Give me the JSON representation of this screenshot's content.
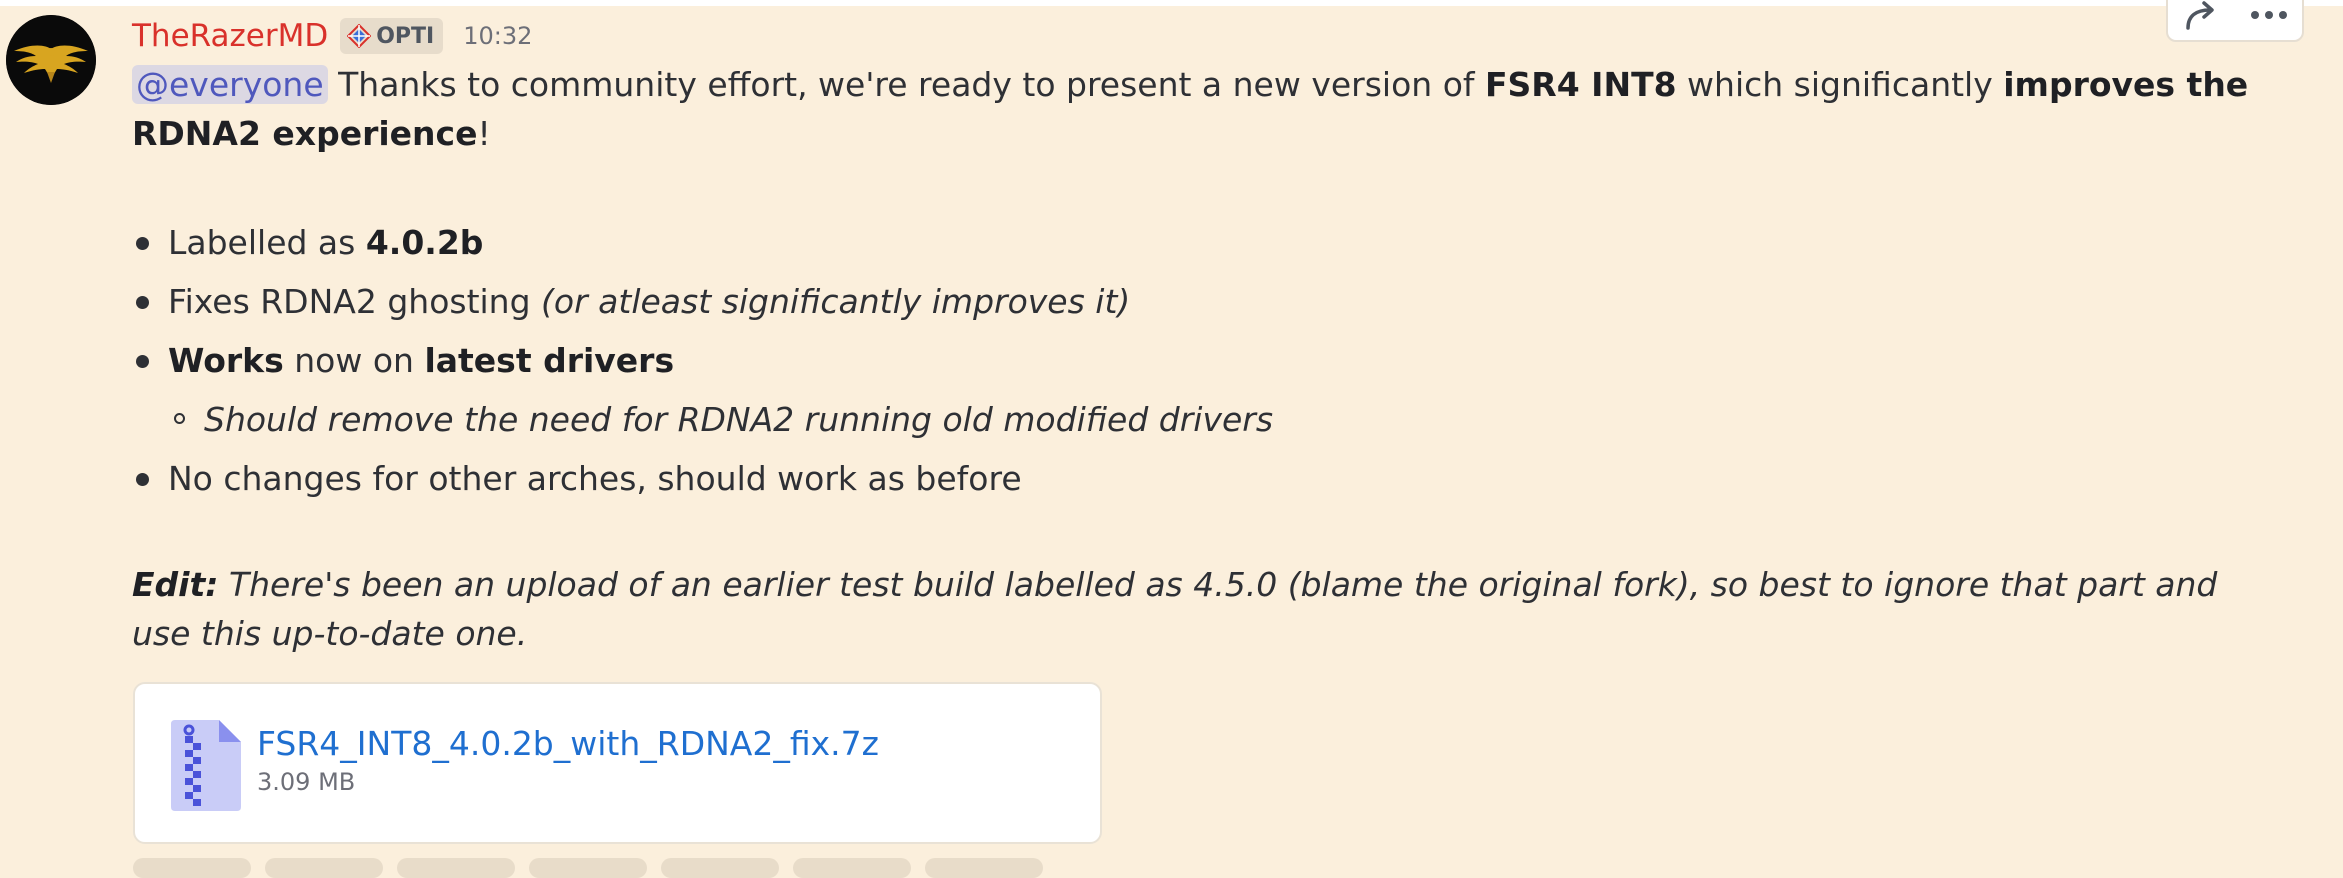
{
  "message": {
    "author": "TheRazerMD",
    "role_tag": "OPTI",
    "timestamp": "10:32",
    "mention": "@everyone",
    "intro": {
      "t1": " Thanks to community effort, we're ready to present a new version of ",
      "b1": "FSR4 INT8",
      "t2": " which significantly ",
      "b2": "improves the RDNA2 experience",
      "t3": "!"
    },
    "bullets": [
      {
        "t1": "Labelled as ",
        "b1": "4.0.2b"
      },
      {
        "t1": "Fixes RDNA2 ghosting ",
        "i1": "(or atleast significantly improves it)"
      },
      {
        "b1": "Works",
        "t1": " now on ",
        "b2": "latest drivers"
      },
      {
        "sub": "Should remove the need for RDNA2 running old modified drivers"
      },
      {
        "t1": "No changes for other arches, should work as before"
      }
    ],
    "edit": {
      "label": "Edit:",
      "text": " There's been an upload of an earlier test build labelled as 4.5.0 (blame the original fork), so best to ignore that part and use this up-to-date one."
    }
  },
  "attachment": {
    "name": "FSR4_INT8_4.0.2b_with_RDNA2_fix.7z",
    "size": "3.09 MB",
    "icon": "zip-file-icon"
  },
  "toolbar": {
    "icons": [
      "reply-arrow-icon",
      "more-dots-icon"
    ]
  },
  "colors": {
    "background": "#fbefdc",
    "username": "#d9312b",
    "mention_bg": "#dcd8e3",
    "mention_text": "#4f58bd",
    "link": "#1f6fd0"
  }
}
